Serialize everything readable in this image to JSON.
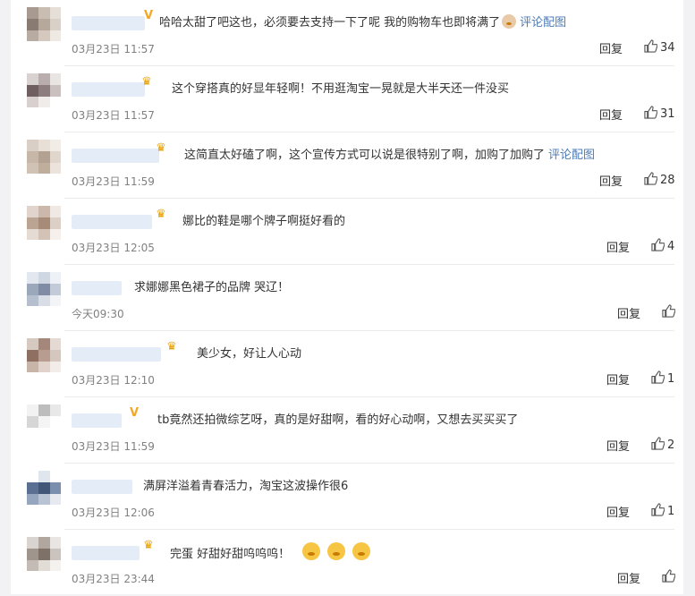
{
  "comments": [
    {
      "badge": "v",
      "text": "哈哈太甜了吧这也，必须要去支持一下了呢 我的购物车也即将满了",
      "emoji": "cat",
      "link": "评论配图",
      "time": "03月23日 11:57",
      "reply": "回复",
      "likes": "34"
    },
    {
      "badge": "crown",
      "text": "这个穿搭真的好显年轻啊！不用逛淘宝一晃就是大半天还一件没买",
      "emoji": "",
      "link": "",
      "time": "03月23日 11:57",
      "reply": "回复",
      "likes": "31"
    },
    {
      "badge": "crown",
      "text": "这简直太好磕了啊，这个宣传方式可以说是很特别了啊，加购了加购了",
      "emoji": "",
      "link": "评论配图",
      "time": "03月23日 11:59",
      "reply": "回复",
      "likes": "28"
    },
    {
      "badge": "crown",
      "text": "娜比的鞋是哪个牌子啊挺好看的",
      "emoji": "",
      "link": "",
      "time": "03月23日 12:05",
      "reply": "回复",
      "likes": "4"
    },
    {
      "badge": "",
      "text": "求娜娜黑色裙子的品牌 哭辽！",
      "emoji": "",
      "link": "",
      "time": "今天09:30",
      "reply": "回复",
      "likes": ""
    },
    {
      "badge": "crown",
      "text": "美少女，好让人心动",
      "emoji": "",
      "link": "",
      "time": "03月23日 12:10",
      "reply": "回复",
      "likes": "1"
    },
    {
      "badge": "v",
      "text": "tb竟然还拍微综艺呀，真的是好甜啊，看的好心动啊，又想去买买买了",
      "emoji": "",
      "link": "",
      "time": "03月23日 11:59",
      "reply": "回复",
      "likes": "2"
    },
    {
      "badge": "",
      "text": "满屏洋溢着青春活力，淘宝这波操作很6",
      "emoji": "",
      "link": "",
      "time": "03月23日 12:06",
      "reply": "回复",
      "likes": "1"
    },
    {
      "badge": "crown",
      "text": "完蛋 好甜好甜呜呜呜！",
      "emoji": "blush",
      "link": "",
      "time": "03月23日 23:44",
      "reply": "回复",
      "likes": ""
    }
  ],
  "icons": {
    "verified": "v-badge-icon",
    "member": "crown-icon",
    "like": "thumbs-up-icon"
  },
  "colors": {
    "link": "#4a7bb7",
    "time": "#808080",
    "verified": "#f5a623"
  }
}
